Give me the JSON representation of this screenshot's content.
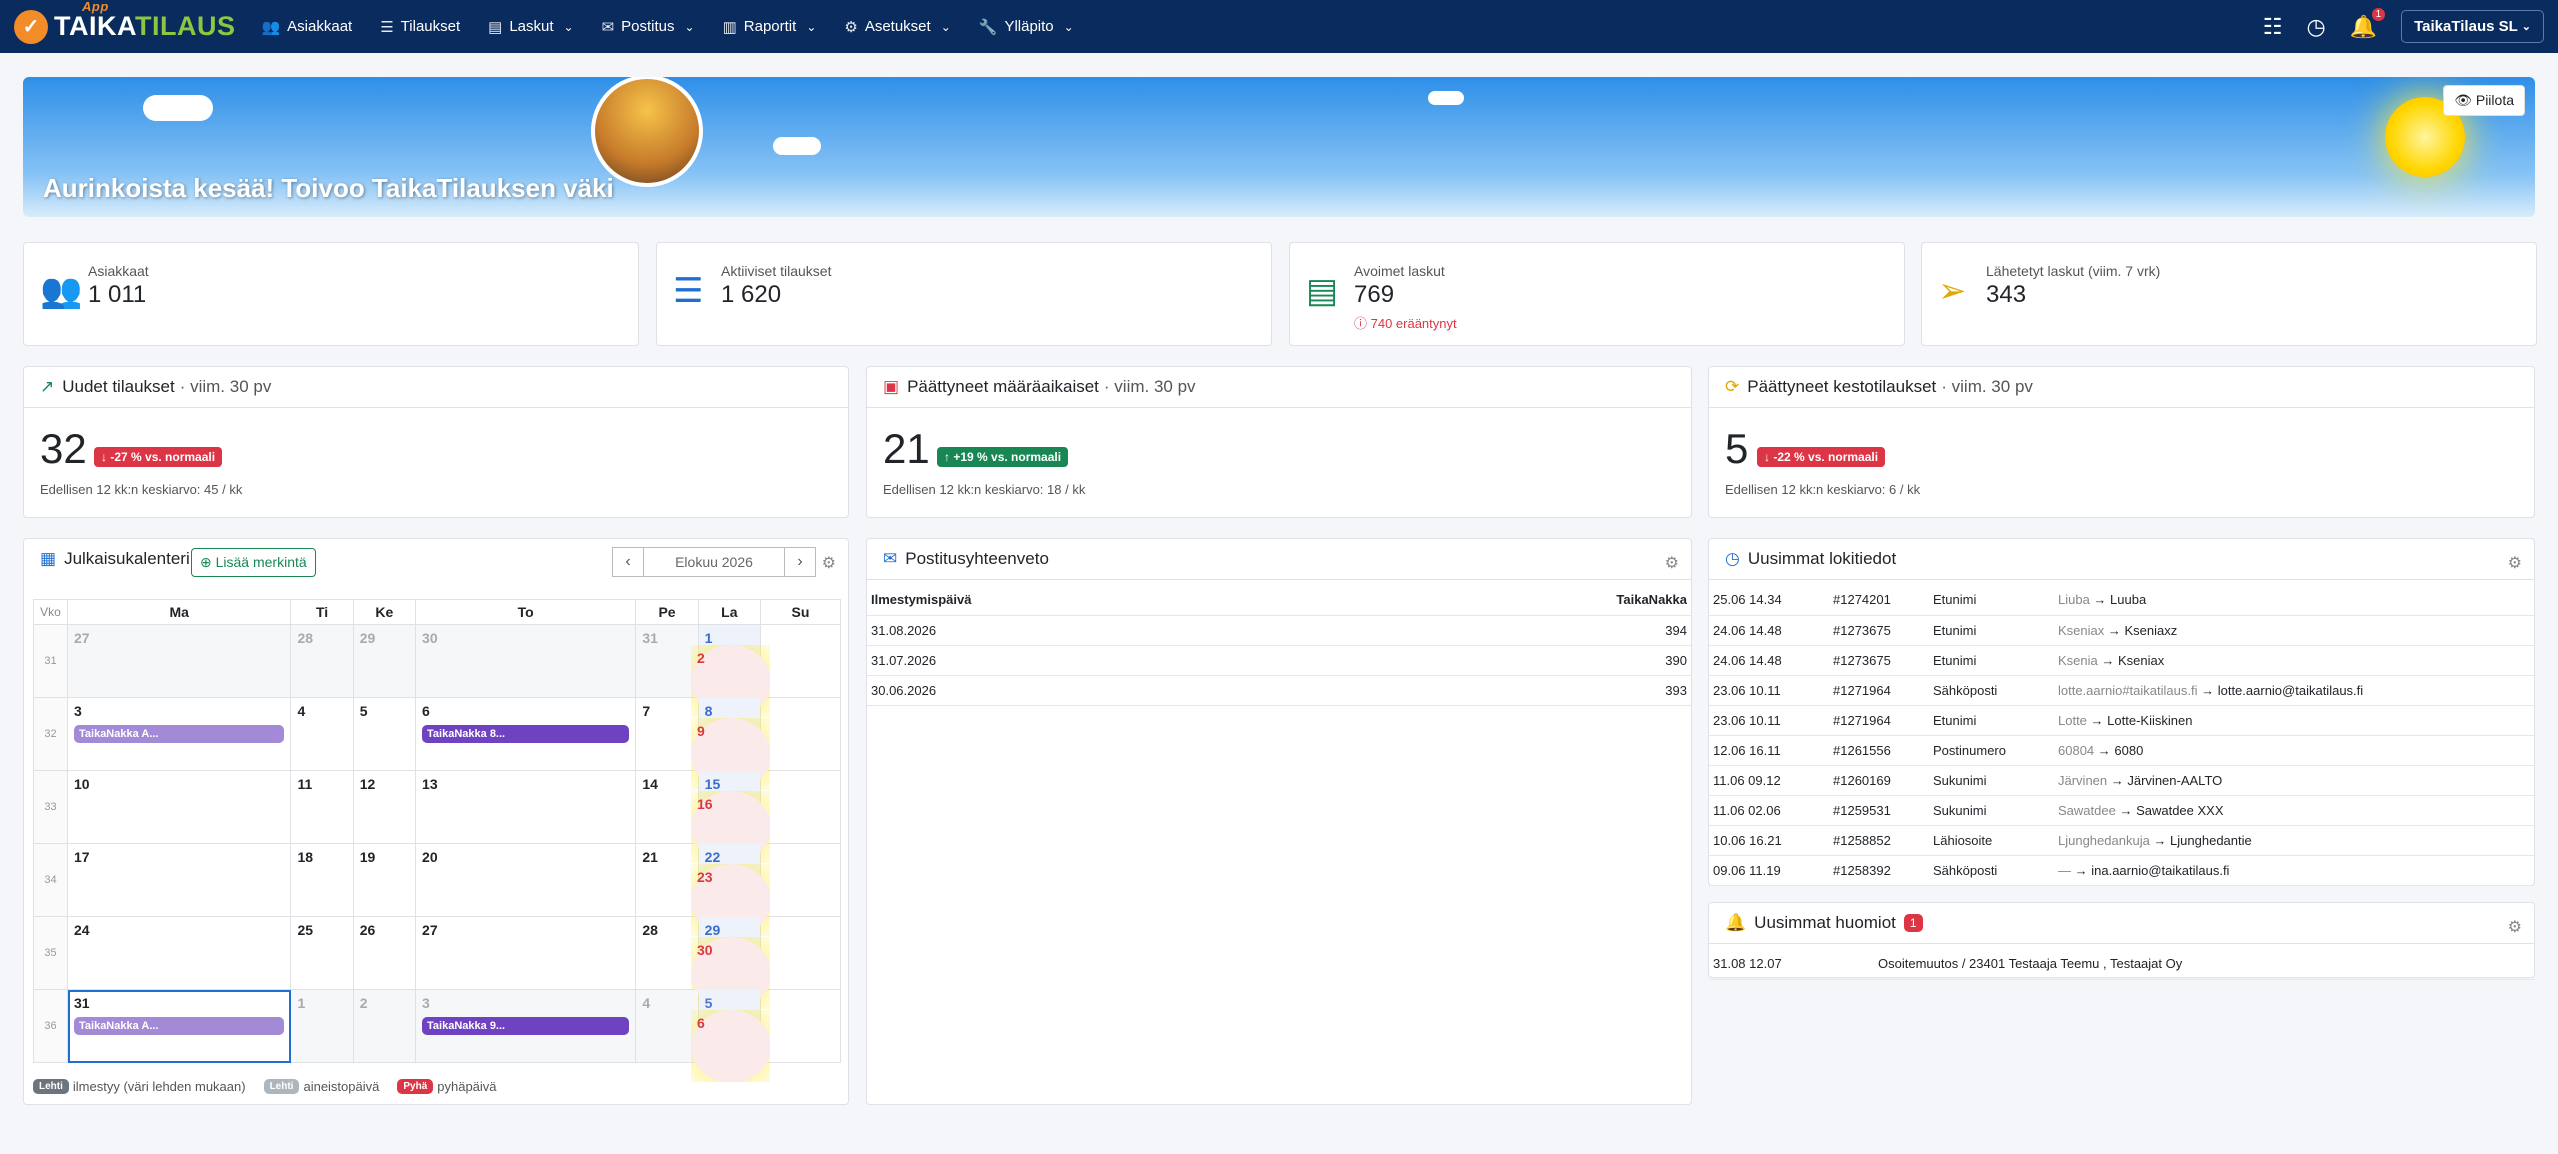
{
  "nav": {
    "logo_a": "TAIKA",
    "logo_b": "TILAUS",
    "logo_app": "App",
    "items": [
      {
        "label": "Asiakkaat",
        "icon": "users-icon",
        "glyph": "👥",
        "dropdown": false
      },
      {
        "label": "Tilaukset",
        "icon": "list-icon",
        "glyph": "☰",
        "dropdown": false
      },
      {
        "label": "Laskut",
        "icon": "invoice-icon",
        "glyph": "▤",
        "dropdown": true
      },
      {
        "label": "Postitus",
        "icon": "mail-icon",
        "glyph": "✉",
        "dropdown": true
      },
      {
        "label": "Raportit",
        "icon": "chart-icon",
        "glyph": "▥",
        "dropdown": true
      },
      {
        "label": "Asetukset",
        "icon": "gear-icon",
        "glyph": "⚙",
        "dropdown": true
      },
      {
        "label": "Ylläpito",
        "icon": "wrench-icon",
        "glyph": "🔧",
        "dropdown": true
      }
    ],
    "notif_count": "1",
    "company": "TaikaTilaus SL"
  },
  "banner": {
    "text": "Aurinkoista kesää! Toivoo TaikaTilauksen väki",
    "hide": "Piilota"
  },
  "stats": [
    {
      "label": "Asiakkaat",
      "value": "1 011",
      "icon": "users-icon",
      "glyph": "👥",
      "color": "#17a2b8",
      "sub": ""
    },
    {
      "label": "Aktiiviset tilaukset",
      "value": "1 620",
      "icon": "list-icon",
      "glyph": "☰",
      "color": "#1f6fd1",
      "sub": ""
    },
    {
      "label": "Avoimet laskut",
      "value": "769",
      "icon": "receipt-icon",
      "glyph": "▤",
      "color": "#198754",
      "sub": "ⓘ 740 erääntynyt"
    },
    {
      "label": "Lähetetyt laskut (viim. 7 vrk)",
      "value": "343",
      "icon": "send-icon",
      "glyph": "➢",
      "color": "#e0a800",
      "sub": ""
    }
  ],
  "trends": [
    {
      "title": "Uudet tilaukset",
      "period": "· viim. 30 pv",
      "value": "32",
      "pill": "↓ -27 % vs. normaali",
      "pill_color": "#dc3545",
      "foot": "Edellisen 12 kk:n keskiarvo: 45 / kk",
      "icon": "trend-icon",
      "glyph": "↗",
      "color": "#198754"
    },
    {
      "title": "Päättyneet määräaikaiset",
      "period": "· viim. 30 pv",
      "value": "21",
      "pill": "↑ +19 % vs. normaali",
      "pill_color": "#198754",
      "foot": "Edellisen 12 kk:n keskiarvo: 18 / kk",
      "icon": "calendar-x-icon",
      "glyph": "▣",
      "color": "#dc3545"
    },
    {
      "title": "Päättyneet kestotilaukset",
      "period": "· viim. 30 pv",
      "value": "5",
      "pill": "↓ -22 % vs. normaali",
      "pill_color": "#dc3545",
      "foot": "Edellisen 12 kk:n keskiarvo: 6 / kk",
      "icon": "refresh-icon",
      "glyph": "⟳",
      "color": "#e0a800"
    }
  ],
  "calendar": {
    "title": "Julkaisukalenteri",
    "add": "⊕ Lisää merkintä",
    "month": "Elokuu 2026",
    "headers": [
      "Vko",
      "Ma",
      "Ti",
      "Ke",
      "To",
      "Pe",
      "La",
      "Su"
    ],
    "weeks": [
      {
        "no": "31",
        "days": [
          {
            "d": "27",
            "o": 1
          },
          {
            "d": "28",
            "o": 1
          },
          {
            "d": "29",
            "o": 1
          },
          {
            "d": "30",
            "o": 1
          },
          {
            "d": "31",
            "o": 1
          },
          {
            "d": "1"
          },
          {
            "d": "2"
          }
        ]
      },
      {
        "no": "32",
        "days": [
          {
            "d": "3",
            "ev": "TaikaNakka A...",
            "evc": "light"
          },
          {
            "d": "4"
          },
          {
            "d": "5"
          },
          {
            "d": "6",
            "ev": "TaikaNakka 8...",
            "evc": "dark"
          },
          {
            "d": "7"
          },
          {
            "d": "8"
          },
          {
            "d": "9"
          }
        ]
      },
      {
        "no": "33",
        "days": [
          {
            "d": "10"
          },
          {
            "d": "11"
          },
          {
            "d": "12"
          },
          {
            "d": "13"
          },
          {
            "d": "14"
          },
          {
            "d": "15"
          },
          {
            "d": "16"
          }
        ]
      },
      {
        "no": "34",
        "days": [
          {
            "d": "17"
          },
          {
            "d": "18"
          },
          {
            "d": "19"
          },
          {
            "d": "20"
          },
          {
            "d": "21"
          },
          {
            "d": "22"
          },
          {
            "d": "23"
          }
        ]
      },
      {
        "no": "35",
        "days": [
          {
            "d": "24"
          },
          {
            "d": "25"
          },
          {
            "d": "26"
          },
          {
            "d": "27"
          },
          {
            "d": "28"
          },
          {
            "d": "29"
          },
          {
            "d": "30"
          }
        ]
      },
      {
        "no": "36",
        "days": [
          {
            "d": "31",
            "sel": 1,
            "ev": "TaikaNakka A...",
            "evc": "light"
          },
          {
            "d": "1",
            "o": 1
          },
          {
            "d": "2",
            "o": 1
          },
          {
            "d": "3",
            "o": 1,
            "ev": "TaikaNakka 9...",
            "evc": "dark"
          },
          {
            "d": "4",
            "o": 1
          },
          {
            "d": "5",
            "o": 1
          },
          {
            "d": "6",
            "o": 1
          }
        ]
      }
    ],
    "legend": [
      {
        "tag": "Lehti",
        "text": "ilmestyy (väri lehden mukaan)",
        "color": "#6c757d"
      },
      {
        "tag": "Lehti",
        "text": "aineistopäivä",
        "color": "#adb5bd"
      },
      {
        "tag": "Pyhä",
        "text": "pyhäpäivä",
        "color": "#dc3545"
      }
    ]
  },
  "postitus": {
    "title": "Postitusyhteenveto",
    "col1": "Ilmestymispäivä",
    "col2": "TaikaNakka",
    "rows": [
      [
        "31.08.2026",
        "394"
      ],
      [
        "31.07.2026",
        "390"
      ],
      [
        "30.06.2026",
        "393"
      ]
    ]
  },
  "log": {
    "title": "Uusimmat lokitiedot",
    "rows": [
      [
        "25.06 14.34",
        "#1274201",
        "Etunimi",
        "Liuba",
        "Luuba"
      ],
      [
        "24.06 14.48",
        "#1273675",
        "Etunimi",
        "Kseniax",
        "Kseniaxz"
      ],
      [
        "24.06 14.48",
        "#1273675",
        "Etunimi",
        "Ksenia",
        "Kseniax"
      ],
      [
        "23.06 10.11",
        "#1271964",
        "Sähköposti",
        "lotte.aarnio#taikatilaus.fi",
        "lotte.aarnio@taikatilaus.fi"
      ],
      [
        "23.06 10.11",
        "#1271964",
        "Etunimi",
        "Lotte",
        "Lotte-Kiiskinen"
      ],
      [
        "12.06 16.11",
        "#1261556",
        "Postinumero",
        "60804",
        "6080"
      ],
      [
        "11.06 09.12",
        "#1260169",
        "Sukunimi",
        "Järvinen",
        "Järvinen-AALTO"
      ],
      [
        "11.06 02.06",
        "#1259531",
        "Sukunimi",
        "Sawatdee",
        "Sawatdee XXX"
      ],
      [
        "10.06 16.21",
        "#1258852",
        "Lähiosoite",
        "Ljunghedankuja",
        "Ljunghedantie"
      ],
      [
        "09.06 11.19",
        "#1258392",
        "Sähköposti",
        "—",
        "ina.aarnio@taikatilaus.fi"
      ]
    ]
  },
  "notes": {
    "title": "Uusimmat huomiot",
    "count": "1",
    "rows": [
      [
        "31.08 12.07",
        "Osoitemuutos / 23401 Testaaja Teemu , Testaajat Oy"
      ]
    ]
  }
}
